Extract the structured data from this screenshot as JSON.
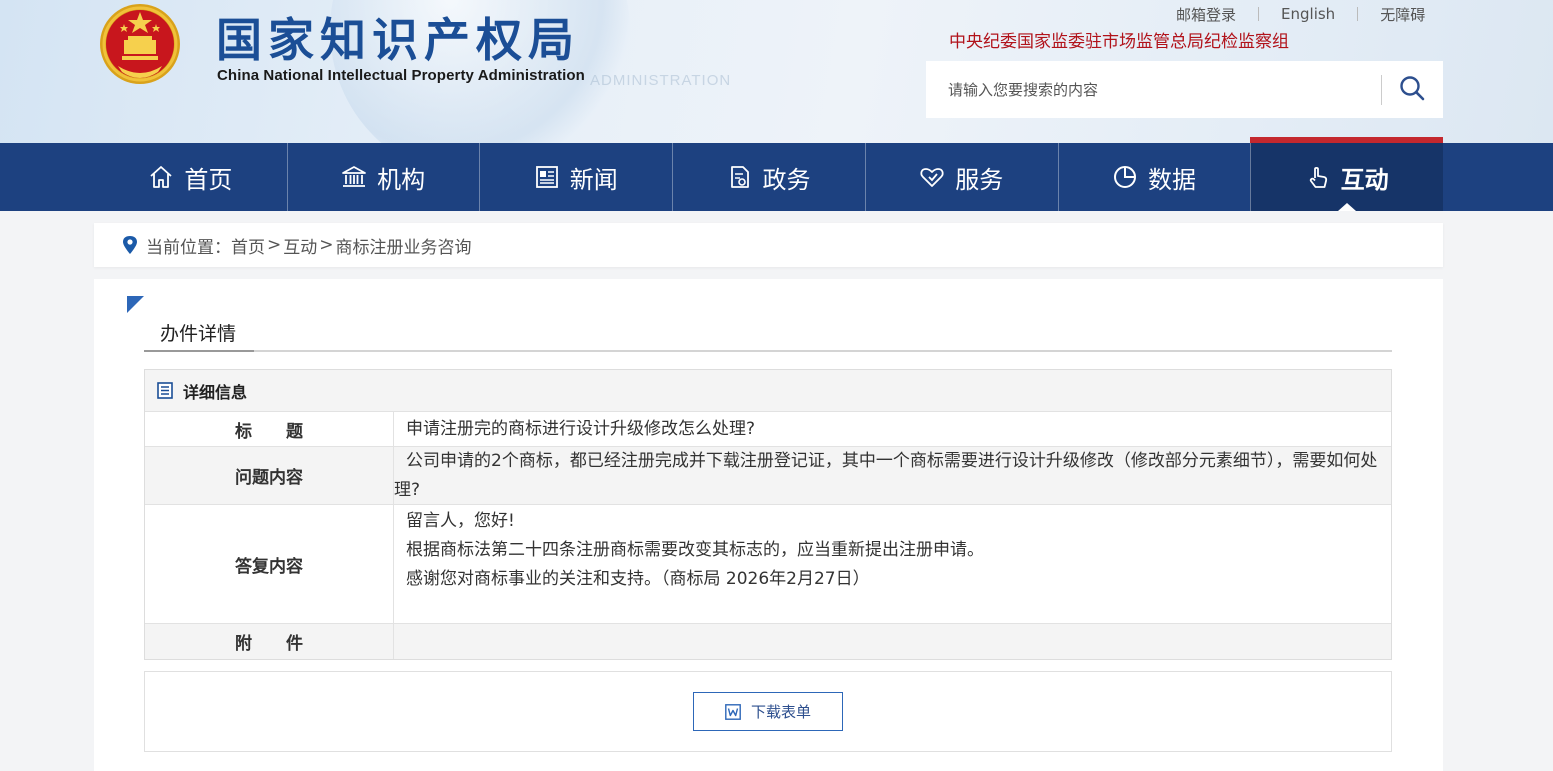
{
  "header": {
    "title": "国家知识产权局",
    "subtitle": "China National Intellectual Property Administration",
    "ghost_text": "ADMINISTRATION",
    "top_links": [
      "邮箱登录",
      "English",
      "无障碍"
    ],
    "supervision": "中央纪委国家监委驻市场监管总局纪检监察组",
    "search_placeholder": "请输入您要搜索的内容",
    "search_icon": "search-icon",
    "emblem_icon": "national-emblem-icon"
  },
  "nav": {
    "items": [
      {
        "label": "首页",
        "icon": "home-icon"
      },
      {
        "label": "机构",
        "icon": "institution-icon"
      },
      {
        "label": "新闻",
        "icon": "news-icon"
      },
      {
        "label": "政务",
        "icon": "document-icon"
      },
      {
        "label": "服务",
        "icon": "heart-hand-icon"
      },
      {
        "label": "数据",
        "icon": "pie-chart-icon"
      },
      {
        "label": "互动",
        "icon": "touch-icon"
      }
    ],
    "active_index": 6,
    "colors": {
      "bar": "#1d4180",
      "active": "#163468",
      "active_top": "#c4282e"
    }
  },
  "breadcrumb": {
    "prefix": "当前位置：",
    "items": [
      "首页",
      "互动",
      "商标注册业务咨询"
    ],
    "separator": ">"
  },
  "section": {
    "tab_label": "办件详情"
  },
  "detail": {
    "head": "详细信息",
    "title_label": "标　　题",
    "title_value": "申请注册完的商标进行设计升级修改怎么处理?",
    "question_label": "问题内容",
    "question_value": "公司申请的2个商标，都已经注册完成并下载注册登记证，其中一个商标需要进行设计升级修改（修改部分元素细节），需要如何处理?",
    "answer_label": "答复内容",
    "answer_lines": [
      "留言人，您好!",
      "根据商标法第二十四条注册商标需要改变其标志的，应当重新提出注册申请。",
      "感谢您对商标事业的关注和支持。（商标局 2026年2月27日）"
    ],
    "attach_label": "附　　件",
    "attach_value": ""
  },
  "download": {
    "label": "下载表单",
    "icon": "word-doc-icon"
  }
}
